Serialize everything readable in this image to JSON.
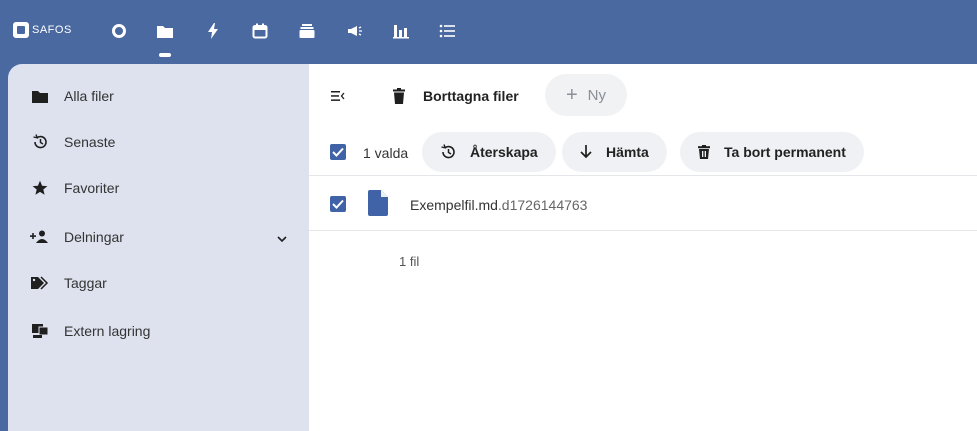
{
  "header": {
    "brand": "SAFOS",
    "apps": [
      {
        "name": "Dashboard",
        "icon": "circle-icon"
      },
      {
        "name": "Filer",
        "icon": "folder-icon",
        "active": true
      },
      {
        "name": "Aktivitet",
        "icon": "lightning-icon"
      },
      {
        "name": "Kalender",
        "icon": "calendar-icon"
      },
      {
        "name": "Anteckningar",
        "icon": "stack-icon"
      },
      {
        "name": "Meddelanden",
        "icon": "megaphone-icon"
      },
      {
        "name": "Analys",
        "icon": "bar-chart-icon"
      },
      {
        "name": "Uppgifter",
        "icon": "list-icon"
      }
    ]
  },
  "sidebar": {
    "items": [
      {
        "label": "Alla filer",
        "icon": "folder-icon"
      },
      {
        "label": "Senaste",
        "icon": "history-icon"
      },
      {
        "label": "Favoriter",
        "icon": "star-icon"
      },
      {
        "label": "Delningar",
        "icon": "share-user-icon"
      },
      {
        "label": "Taggar",
        "icon": "tag-icon"
      },
      {
        "label": "Extern lagring",
        "icon": "external-storage-icon"
      }
    ]
  },
  "breadcrumb": {
    "label": "Borttagna filer",
    "icon": "trash-icon"
  },
  "toolbar": {
    "new_label": "Ny"
  },
  "selection": {
    "count_label": "1 valda",
    "actions": [
      {
        "label": "Återskapa",
        "icon": "restore-icon"
      },
      {
        "label": "Hämta",
        "icon": "download-icon"
      },
      {
        "label": "Ta bort permanent",
        "icon": "delete-icon"
      }
    ]
  },
  "files": [
    {
      "name": "Exempelfil.md",
      "suffix": ".d1726144763",
      "selected": true
    }
  ],
  "summary": "1 fil",
  "colors": {
    "header": "#4a69a0",
    "sidebar": "#dde2ee",
    "accent": "#3f63a6"
  }
}
